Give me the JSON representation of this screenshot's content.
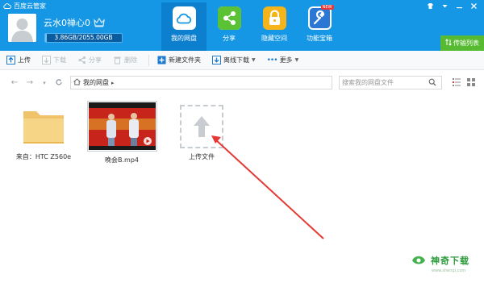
{
  "window": {
    "title": "百度云管家",
    "controls": [
      "skin-icon",
      "menu-icon",
      "minimize-icon",
      "close-icon"
    ]
  },
  "user": {
    "name": "云水0禅心0",
    "quota": "3.86GB/2055.00GB",
    "quota_used_fraction": 0.0019
  },
  "nav": {
    "items": [
      {
        "label": "我的网盘",
        "icon": "cloud-icon",
        "active": true
      },
      {
        "label": "分享",
        "icon": "share-icon",
        "active": false
      },
      {
        "label": "隐藏空间",
        "icon": "lock-icon",
        "active": false
      },
      {
        "label": "功能宝箱",
        "icon": "toolbox-icon",
        "badge": "NEW",
        "active": false
      }
    ],
    "transfer_label": "传输列表"
  },
  "toolbar": {
    "upload": "上传",
    "download": "下载",
    "share": "分享",
    "delete": "删除",
    "new_folder": "新建文件夹",
    "offline_download": "离线下载",
    "more": "更多"
  },
  "address": {
    "crumb": "我的网盘",
    "search_placeholder": "搜索我的网盘文件"
  },
  "files": [
    {
      "name": "来自：HTC Z560e",
      "type": "folder"
    },
    {
      "name": "晚会B.mp4",
      "type": "video"
    },
    {
      "name": "上传文件",
      "type": "upload"
    }
  ],
  "watermark": {
    "brand": "神奇下载",
    "url": "www.shenqi.com"
  },
  "colors": {
    "header": "#1597e5",
    "nav_active": "#0d7fcf",
    "transfer": "#57ba33",
    "arrow": "#e53935"
  }
}
